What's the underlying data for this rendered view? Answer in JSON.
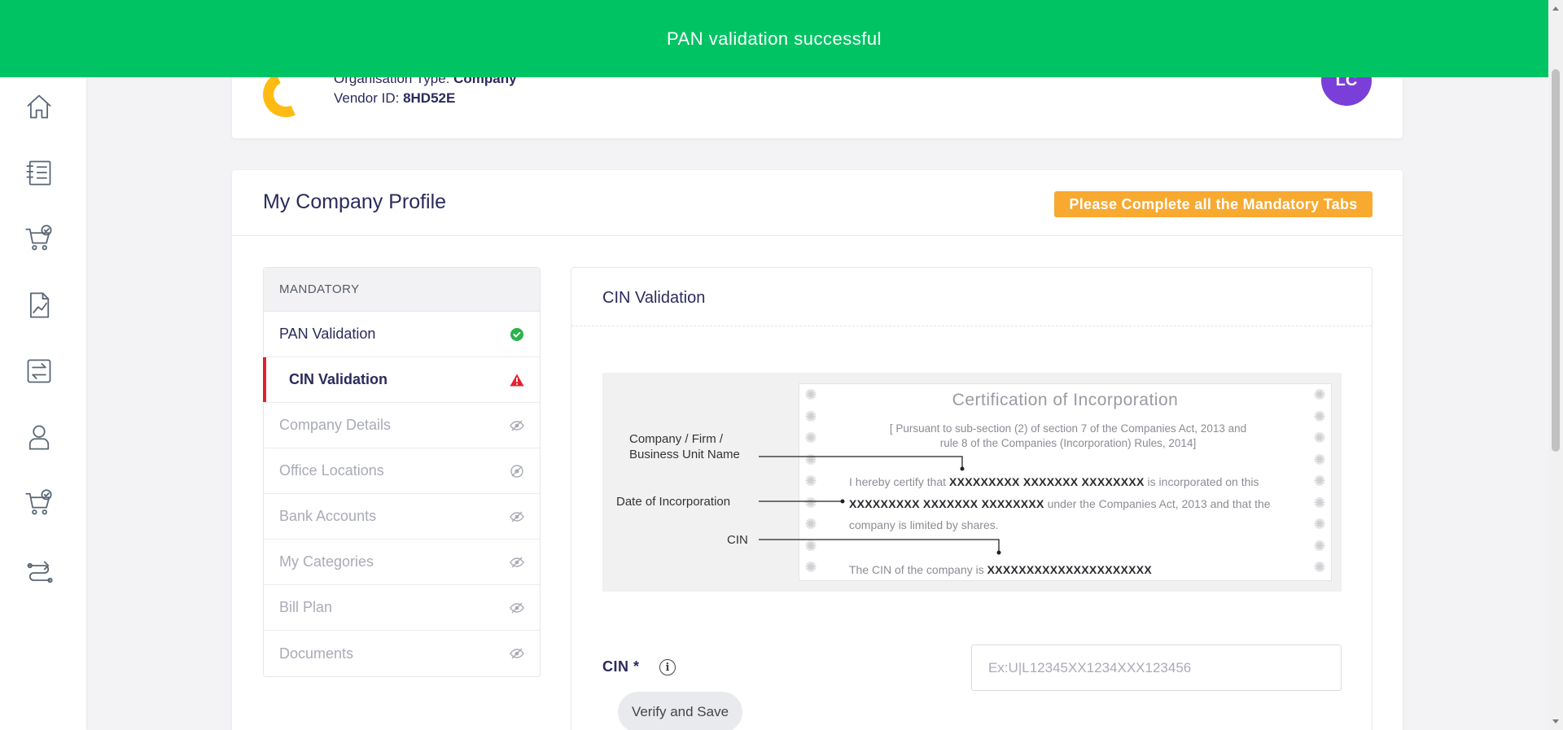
{
  "toast": {
    "message": "PAN validation successful",
    "color": "#00c463"
  },
  "header": {
    "org_type_label": "Organisation Type:",
    "org_type_value": "Company",
    "vendor_id_label": "Vendor ID:",
    "vendor_id_value": "8HD52E",
    "avatar_initials": "LC"
  },
  "sidebar": {
    "items": [
      {
        "icon": "home-icon"
      },
      {
        "icon": "catalog-icon"
      },
      {
        "icon": "cart-check-icon"
      },
      {
        "icon": "report-chart-icon"
      },
      {
        "icon": "transfer-icon"
      },
      {
        "icon": "user-icon"
      },
      {
        "icon": "cart-check-icon"
      },
      {
        "icon": "delivery-icon"
      }
    ]
  },
  "profile": {
    "title": "My Company Profile",
    "badge": "Please Complete all the Mandatory Tabs",
    "badge_color": "#f8a930"
  },
  "tabs": {
    "heading": "MANDATORY",
    "items": [
      {
        "label": "PAN Validation",
        "status": "done",
        "icon": "check-circle-icon"
      },
      {
        "label": "CIN Validation",
        "status": "active",
        "icon": "warning-icon"
      },
      {
        "label": "Company Details",
        "status": "disabled",
        "icon": "eye-off-icon"
      },
      {
        "label": "Office Locations",
        "status": "disabled",
        "icon": "eye-off-icon"
      },
      {
        "label": "Bank Accounts",
        "status": "disabled",
        "icon": "eye-off-icon"
      },
      {
        "label": "My Categories",
        "status": "disabled",
        "icon": "eye-off-icon"
      },
      {
        "label": "Bill Plan",
        "status": "disabled",
        "icon": "eye-off-icon"
      },
      {
        "label": "Documents",
        "status": "disabled",
        "icon": "eye-off-icon"
      }
    ]
  },
  "cin": {
    "title": "CIN Validation",
    "certificate": {
      "title": "Certification of Incorporation",
      "subtitle_1": "[ Pursuant to sub-section (2) of section 7 of the Companies Act, 2013 and",
      "subtitle_2": "rule 8 of the Companies (Incorporation) Rules, 2014]",
      "body_1": "I hereby certify that",
      "placeholder_name": "XXXXXXXXX XXXXXXX XXXXXXXX",
      "body_2": "is incorporated on this",
      "placeholder_date": "XXXXXXXXX XXXXXXX XXXXXXXX",
      "body_3": "under the Companies Act, 2013 and that the company is limited by shares.",
      "cin_prefix": "The CIN of the company is",
      "placeholder_cin": "XXXXXXXXXXXXXXXXXXXXX",
      "label_company_line1": "Company / Firm /",
      "label_company_line2": "Business Unit Name",
      "label_date": "Date of Incorporation",
      "label_cin": "CIN"
    },
    "field_label": "CIN *",
    "input_placeholder": "Ex:U|L12345XX1234XXX123456",
    "input_value": "",
    "verify_button": "Verify and Save"
  }
}
